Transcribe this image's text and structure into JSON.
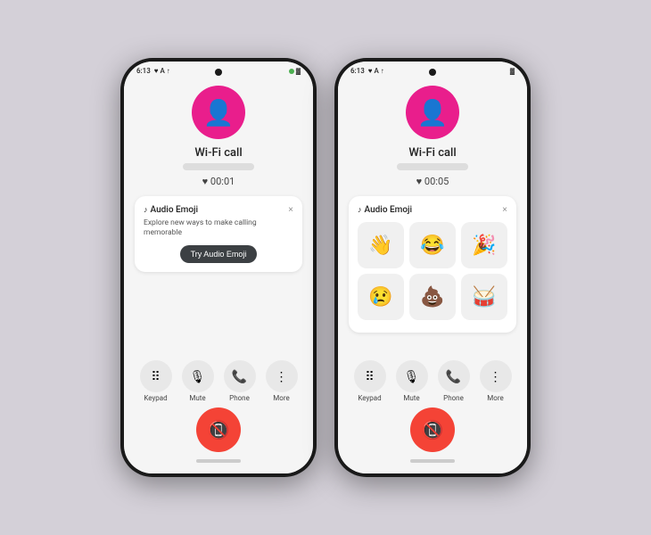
{
  "phone1": {
    "status_time": "6:13",
    "status_icons": "♥ A ↑",
    "has_green_dot": true,
    "caller_name": "Wi-Fi call",
    "timer": "♥ 00:01",
    "card_title": "Audio Emoji",
    "card_desc": "Explore new ways to make calling memorable",
    "try_button": "Try Audio Emoji",
    "close_label": "×",
    "buttons": [
      {
        "icon": "⠿",
        "label": "Keypad"
      },
      {
        "icon": "🎙",
        "label": "Mute"
      },
      {
        "icon": "📞",
        "label": "Phone"
      },
      {
        "icon": "⋮",
        "label": "More"
      }
    ]
  },
  "phone2": {
    "status_time": "6:13",
    "status_icons": "♥ A ↑",
    "has_green_dot": false,
    "caller_name": "Wi-Fi call",
    "timer": "♥ 00:05",
    "card_title": "Audio Emoji",
    "close_label": "×",
    "emojis": [
      "👋",
      "😂",
      "🎉",
      "😢",
      "💩",
      "🥁"
    ],
    "buttons": [
      {
        "icon": "⠿",
        "label": "Keypad"
      },
      {
        "icon": "🎙",
        "label": "Mute"
      },
      {
        "icon": "📞",
        "label": "Phone"
      },
      {
        "icon": "⋮",
        "label": "More"
      }
    ]
  }
}
